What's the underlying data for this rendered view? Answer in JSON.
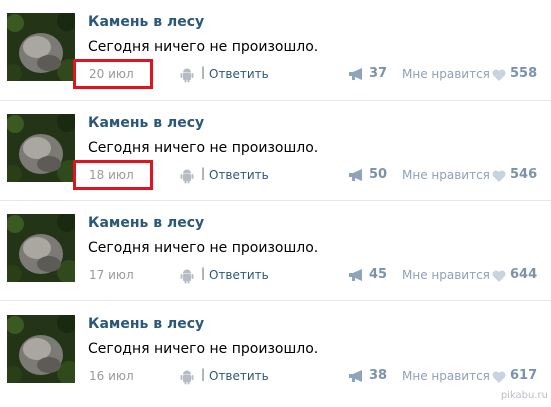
{
  "colors": {
    "author": "#2b587a",
    "date": "#999999",
    "highlight": "#e0141e",
    "counter": "#7b92ac"
  },
  "icons": {
    "avatar": "rock-in-forest-photo",
    "device": "android-icon",
    "share": "megaphone-icon",
    "like": "heart-icon"
  },
  "posts": [
    {
      "author": "Камень в лесу",
      "text": "Сегодня ничего не произошло.",
      "date": "20 июл",
      "reply_label": "Ответить",
      "separator": "|",
      "shares": "37",
      "like_label": "Мне нравится",
      "likes": "558",
      "date_highlighted": true
    },
    {
      "author": "Камень в лесу",
      "text": "Сегодня ничего не произошло.",
      "date": "18 июл",
      "reply_label": "Ответить",
      "separator": "|",
      "shares": "50",
      "like_label": "Мне нравится",
      "likes": "546",
      "date_highlighted": true
    },
    {
      "author": "Камень в лесу",
      "text": "Сегодня ничего не произошло.",
      "date": "17 июл",
      "reply_label": "Ответить",
      "separator": "|",
      "shares": "45",
      "like_label": "Мне нравится",
      "likes": "644",
      "date_highlighted": false
    },
    {
      "author": "Камень в лесу",
      "text": "Сегодня ничего не произошло.",
      "date": "16 июл",
      "reply_label": "Ответить",
      "separator": "|",
      "shares": "38",
      "like_label": "Мне нравится",
      "likes": "617",
      "date_highlighted": false
    }
  ],
  "watermark": "pikabu.ru"
}
